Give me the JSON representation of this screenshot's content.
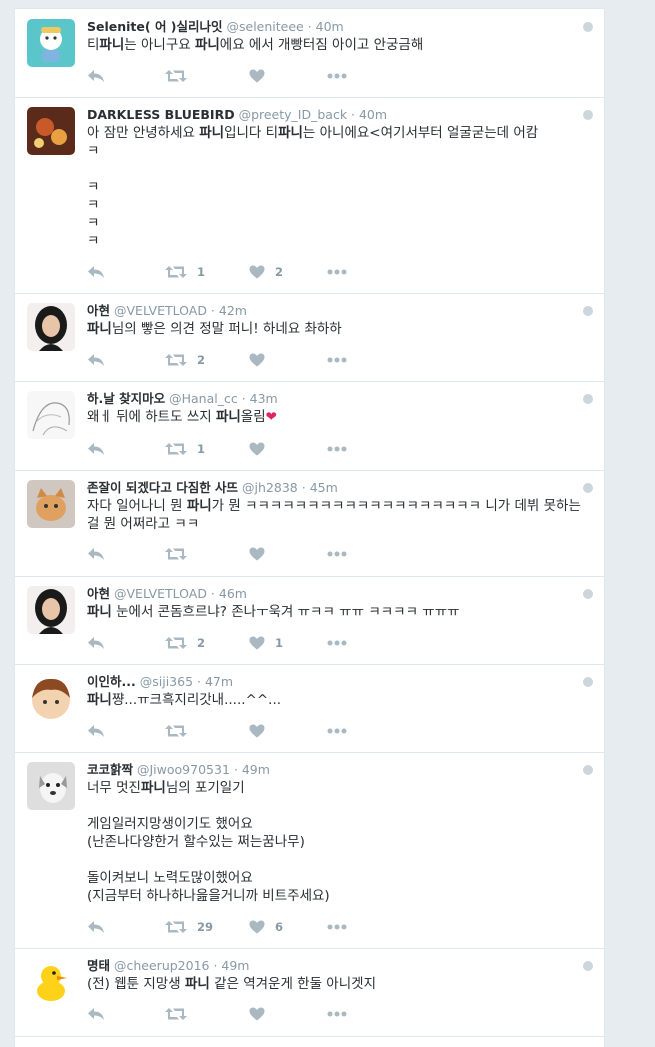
{
  "tweets": [
    {
      "name": "Selenite( 어 )실리나잇",
      "handle": "@seleniteee",
      "time": "40m",
      "text": "티파니는 아니구요 파니에요 에서 개빵터짐 아이고 안궁금해",
      "retweets": "",
      "likes": ""
    },
    {
      "name": "DARKLESS BLUEBIRD",
      "handle": "@preety_ID_back",
      "time": "40m",
      "text": "아 잠만 안녕하세요 파니입니다 티파니는 아니에요<여기서부터 얼굴굳는데 어캄\nㅋ\n\nㅋ\nㅋ\nㅋ\nㅋ",
      "retweets": "1",
      "likes": "2"
    },
    {
      "name": "아현",
      "handle": "@VELVETLOAD",
      "time": "42m",
      "text": "파니님의 빻은 의견 정말 퍼니! 하네요 촤하하",
      "retweets": "2",
      "likes": ""
    },
    {
      "name": "하.날 찾지마오",
      "handle": "@Hanal_cc",
      "time": "43m",
      "text": "왜ㅔ 뒤에 하트도 쓰지 파니올림",
      "retweets": "1",
      "likes": ""
    },
    {
      "name": "존잘이 되겠다고 다짐한 사뜨",
      "handle": "@jh2838",
      "time": "45m",
      "text": "자다 일어나니 뭔 파니가 뭔 ㅋㅋㅋㅋㅋㅋㅋㅋㅋㅋㅋㅋㅋㅋㅋㅋㅋㅋㅋ 니가 데뷔 못하는걸 뭔 어쩌라고 ㅋㅋ",
      "retweets": "",
      "likes": ""
    },
    {
      "name": "아현",
      "handle": "@VELVETLOAD",
      "time": "46m",
      "text": "파니 눈에서 콘돔흐르냐? 존나ㅜ욱겨 ㅠㅋㅋ ㅠㅠ ㅋㅋㅋㅋ ㅠㅠㅠ",
      "retweets": "2",
      "likes": "1"
    },
    {
      "name": "이인하...",
      "handle": "@siji365",
      "time": "47m",
      "text": "파니쨩...ㅠ크흑지리갓내.....^^...",
      "retweets": "",
      "likes": ""
    },
    {
      "name": "코코핡짝",
      "handle": "@Jiwoo970531",
      "time": "49m",
      "text": "너무 멋진파니님의 포기일기\n\n게임일러지망생이기도 했어요\n(난존나다양한거 할수있는 쩌는꿈나무)\n\n돌이켜보니 노력도많이했어요\n(지금부터 하나하나읊을거니까 비트주세요)",
      "retweets": "29",
      "likes": "6"
    },
    {
      "name": "명태",
      "handle": "@cheerup2016",
      "time": "49m",
      "text": "(전) 웹툰 지망생 파니 같은 역겨운게 한둘 아니겟지",
      "retweets": "",
      "likes": ""
    }
  ],
  "colors": {
    "accent": "#1da1f2",
    "icon": "#aab8c2",
    "name": "#292f33",
    "meta": "#8899a6",
    "heart": "#e0245e"
  },
  "icons": {
    "reply": "reply-icon",
    "retweet": "retweet-icon",
    "like": "heart-icon",
    "more": "more-icon",
    "privacy": "globe-icon"
  }
}
